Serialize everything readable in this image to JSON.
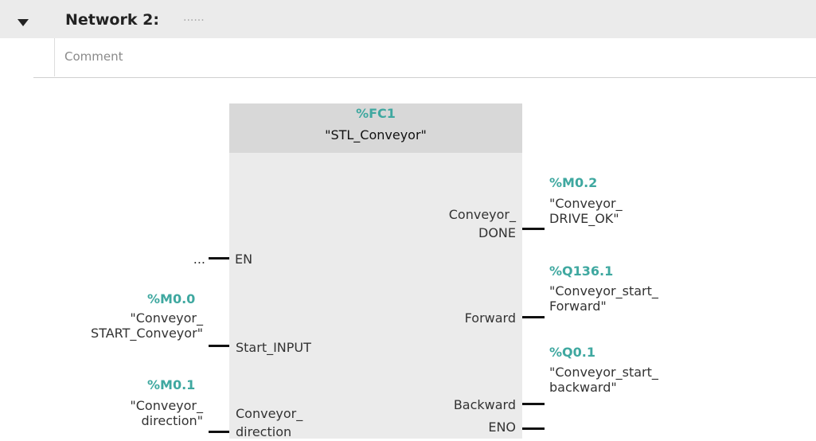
{
  "network": {
    "title": "Network 2:",
    "title_dots": "......",
    "comment_placeholder": "Comment"
  },
  "block": {
    "address": "%FC1",
    "name": "\"STL_Conveyor\""
  },
  "inputs": {
    "en": {
      "pin": "EN",
      "operand": "..."
    },
    "start_input": {
      "pin": "Start_INPUT",
      "address": "%M0.0",
      "tag_line1": "\"Conveyor_",
      "tag_line2": "START_Conveyor\""
    },
    "direction": {
      "pin_line1": "Conveyor_",
      "pin_line2": "direction",
      "address": "%M0.1",
      "tag_line1": "\"Conveyor_",
      "tag_line2": "direction\""
    }
  },
  "outputs": {
    "done": {
      "pin_line1": "Conveyor_",
      "pin_line2": "DONE",
      "address": "%M0.2",
      "tag_line1": "\"Conveyor_",
      "tag_line2": "DRIVE_OK\""
    },
    "forward": {
      "pin": "Forward",
      "address": "%Q136.1",
      "tag_line1": "\"Conveyor_start_",
      "tag_line2": "Forward\""
    },
    "backward": {
      "pin": "Backward",
      "address": "%Q0.1",
      "tag_line1": "\"Conveyor_start_",
      "tag_line2": "backward\""
    },
    "eno": {
      "pin": "ENO"
    }
  },
  "colors": {
    "address": "#3fa8a0",
    "block": "#ebebeb",
    "block_header": "#d8d8d8"
  }
}
